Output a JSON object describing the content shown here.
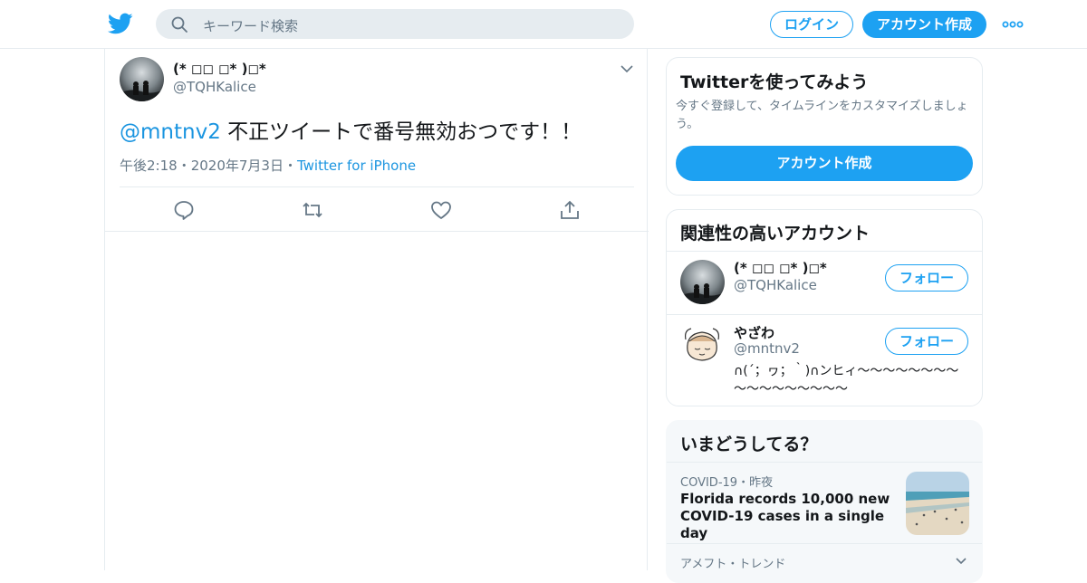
{
  "header": {
    "logo_icon": "twitter-bird-icon",
    "search_placeholder": "キーワード検索",
    "login_label": "ログイン",
    "signup_label": "アカウント作成",
    "more_icon": "more-dots-icon"
  },
  "tweet": {
    "author_name": "(* ◻◻ ◻* )◻*",
    "author_handle": "@TQHKalice",
    "mention": "@mntnv2",
    "text": " 不正ツイートで番号無効おつです！！",
    "time": "午後2:18",
    "dot": "・",
    "date": "2020年7月3日",
    "source": "Twitter for iPhone",
    "actions": [
      "reply-icon",
      "retweet-icon",
      "like-icon",
      "share-icon"
    ]
  },
  "signup_card": {
    "title": "Twitterを使ってみよう",
    "description": "今すぐ登録して、タイムラインをカスタマイズしましょう。",
    "button_label": "アカウント作成"
  },
  "related_accounts": {
    "title": "関連性の高いアカウント",
    "accounts": [
      {
        "name": "(* ◻◻ ◻* )◻*",
        "handle": "@TQHKalice",
        "bio": "",
        "follow_label": "フォロー"
      },
      {
        "name": "やざわ",
        "handle": "@mntnv2",
        "bio": "∩(´；ヮ；｀)∩ンヒィ～～～～～～～～～～～～～～～～～",
        "follow_label": "フォロー"
      }
    ]
  },
  "trends": {
    "title": "いまどうしてる？",
    "items": [
      {
        "category": "COVID-19",
        "dot": "・",
        "time": "昨夜",
        "headline": "Florida records 10,000 new COVID-19 cases in a single day"
      },
      {
        "category": "アメフト・トレンド"
      }
    ]
  },
  "colors": {
    "accent": "#1da1f2",
    "link": "#1b95e0",
    "secondary_text": "#657786",
    "border": "#e6ecf0"
  }
}
